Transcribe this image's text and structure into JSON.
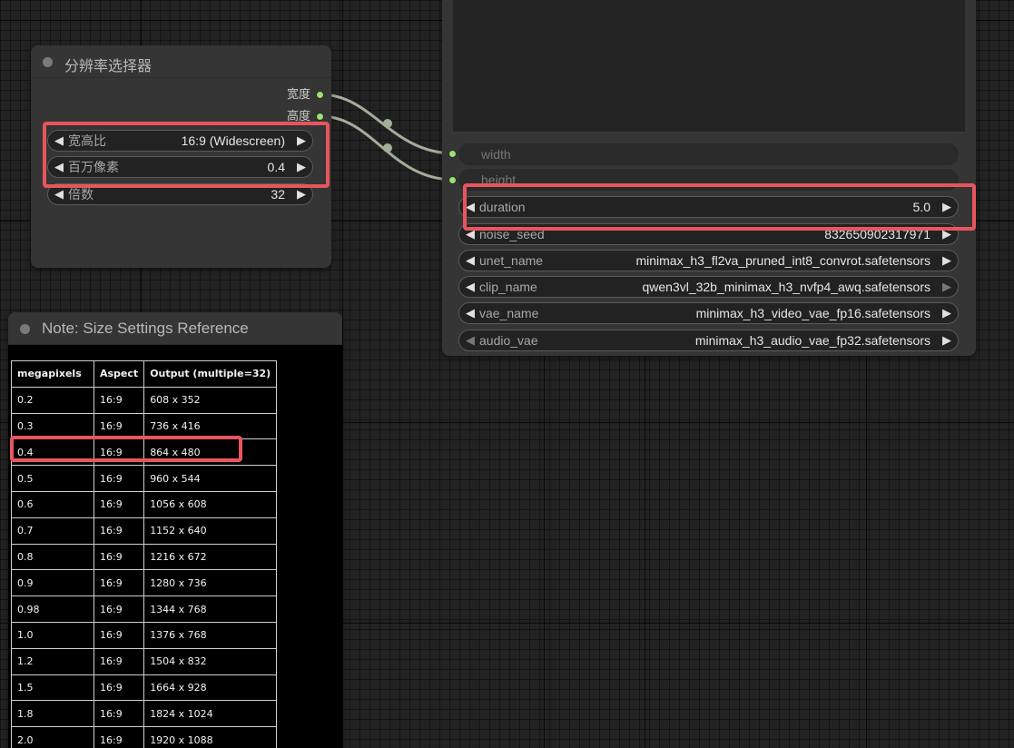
{
  "resolution_node": {
    "title": "分辨率选择器",
    "outputs": [
      "宽度",
      "高度"
    ],
    "widgets": [
      {
        "label": "宽高比",
        "value": "16:9 (Widescreen)"
      },
      {
        "label": "百万像素",
        "value": "0.4"
      },
      {
        "label": "倍数",
        "value": "32"
      }
    ]
  },
  "model_node": {
    "inputs": [
      "width",
      "height"
    ],
    "widgets": [
      {
        "label": "duration",
        "value": "5.0"
      },
      {
        "label": "noise_seed",
        "value": "832650902317971"
      },
      {
        "label": "unet_name",
        "value": "minimax_h3_fl2va_pruned_int8_convrot.safetensors"
      },
      {
        "label": "clip_name",
        "value": "qwen3vl_32b_minimax_h3_nvfp4_awq.safetensors"
      },
      {
        "label": "vae_name",
        "value": "minimax_h3_video_vae_fp16.safetensors"
      },
      {
        "label": "audio_vae",
        "value": "minimax_h3_audio_vae_fp32.safetensors"
      }
    ]
  },
  "note_node": {
    "title": "Note: Size Settings Reference",
    "table": {
      "headers": [
        "megapixels",
        "Aspect",
        "Output (multiple=32)"
      ],
      "rows": [
        [
          "0.2",
          "16:9",
          "608 x 352"
        ],
        [
          "0.3",
          "16:9",
          "736 x 416"
        ],
        [
          "0.4",
          "16:9",
          "864 x 480"
        ],
        [
          "0.5",
          "16:9",
          "960 x 544"
        ],
        [
          "0.6",
          "16:9",
          "1056 x 608"
        ],
        [
          "0.7",
          "16:9",
          "1152 x 640"
        ],
        [
          "0.8",
          "16:9",
          "1216 x 672"
        ],
        [
          "0.9",
          "16:9",
          "1280 x 736"
        ],
        [
          "0.98",
          "16:9",
          "1344 x 768"
        ],
        [
          "1.0",
          "16:9",
          "1376 x 768"
        ],
        [
          "1.2",
          "16:9",
          "1504 x 832"
        ],
        [
          "1.5",
          "16:9",
          "1664 x 928"
        ],
        [
          "1.8",
          "16:9",
          "1824 x 1024"
        ],
        [
          "2.0",
          "16:9",
          "1920 x 1088"
        ]
      ]
    }
  },
  "colors": {
    "canvas": "#222222",
    "node": "#353535",
    "highlight": "#e8555f",
    "slot_dot": "#9be36f",
    "link": "#a3ad99"
  },
  "icons": {
    "decrement": "◀",
    "increment": "▶"
  }
}
